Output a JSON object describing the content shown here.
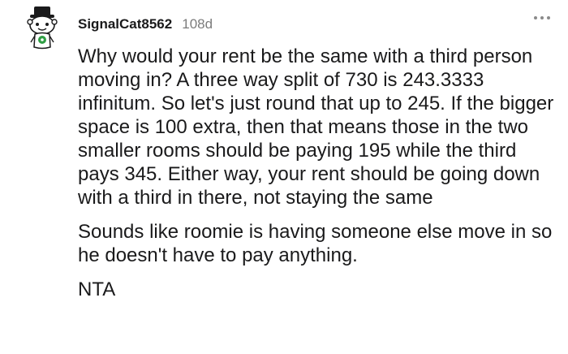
{
  "comment": {
    "username": "SignalCat8562",
    "age": "108d",
    "paragraphs": [
      "Why would your rent be the same with a third person moving in? A three way split of 730 is 243.3333 infinitum. So let's just round that up to 245. If the bigger space is 100 extra, then that means those in the two smaller rooms should be paying 195 while the third pays 345. Either way, your rent should be going down with a third in there, not staying the same",
      "Sounds like roomie is having someone else move in so he doesn't have to pay anything.",
      "NTA"
    ]
  },
  "icons": {
    "avatar": "snoo-avatar-top-hat",
    "more": "more-options-icon"
  }
}
